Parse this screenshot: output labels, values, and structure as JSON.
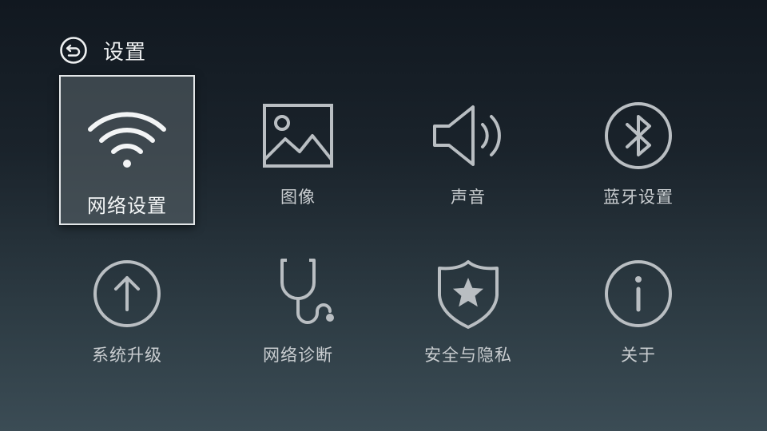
{
  "header": {
    "title": "设置",
    "back_icon": "back-arrow-circle-icon"
  },
  "tiles": [
    {
      "label": "网络设置",
      "icon": "wifi-icon",
      "selected": true
    },
    {
      "label": "图像",
      "icon": "picture-icon",
      "selected": false
    },
    {
      "label": "声音",
      "icon": "speaker-icon",
      "selected": false
    },
    {
      "label": "蓝牙设置",
      "icon": "bluetooth-icon",
      "selected": false
    },
    {
      "label": "系统升级",
      "icon": "upgrade-arrow-icon",
      "selected": false
    },
    {
      "label": "网络诊断",
      "icon": "stethoscope-icon",
      "selected": false
    },
    {
      "label": "安全与隐私",
      "icon": "shield-star-icon",
      "selected": false
    },
    {
      "label": "关于",
      "icon": "info-icon",
      "selected": false
    }
  ],
  "colors": {
    "icon_stroke": "#b9bec2",
    "selected_icon": "#f2f4f5",
    "selection_border": "#e3e6e8"
  }
}
